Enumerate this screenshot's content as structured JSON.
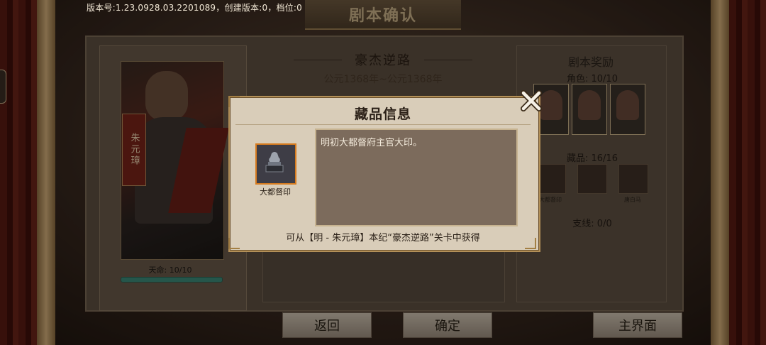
{
  "version_info": "版本号:1.23.0928.03.2201089，创建版本:0，档位:0",
  "page_title": "剧本确认",
  "hero": {
    "name": "朱元璋",
    "fate_label": "天命: 10/10",
    "fate_progress": 1.0
  },
  "script": {
    "name": "豪杰逆路",
    "years": "公元1368年~公元1368年"
  },
  "rewards": {
    "title": "剧本奖励",
    "roles_count": "角色: 10/10",
    "collectibles_count": "藏品: 16/16",
    "branch_count": "支线: 0/0",
    "collectible_labels": [
      "大都督印",
      "",
      "唐白马"
    ]
  },
  "buttons": {
    "back": "返回",
    "confirm": "确定",
    "main_menu": "主界面"
  },
  "modal": {
    "title": "藏品信息",
    "item_name": "大都督印",
    "description": "明初大都督府主官大印。",
    "source": "可从【明 - 朱元璋】本纪“豪杰逆路”关卡中获得"
  },
  "colors": {
    "item_frame": "#d67b1f",
    "fate_bar": "#3c8c7a",
    "frame_gold": "#b39058"
  }
}
